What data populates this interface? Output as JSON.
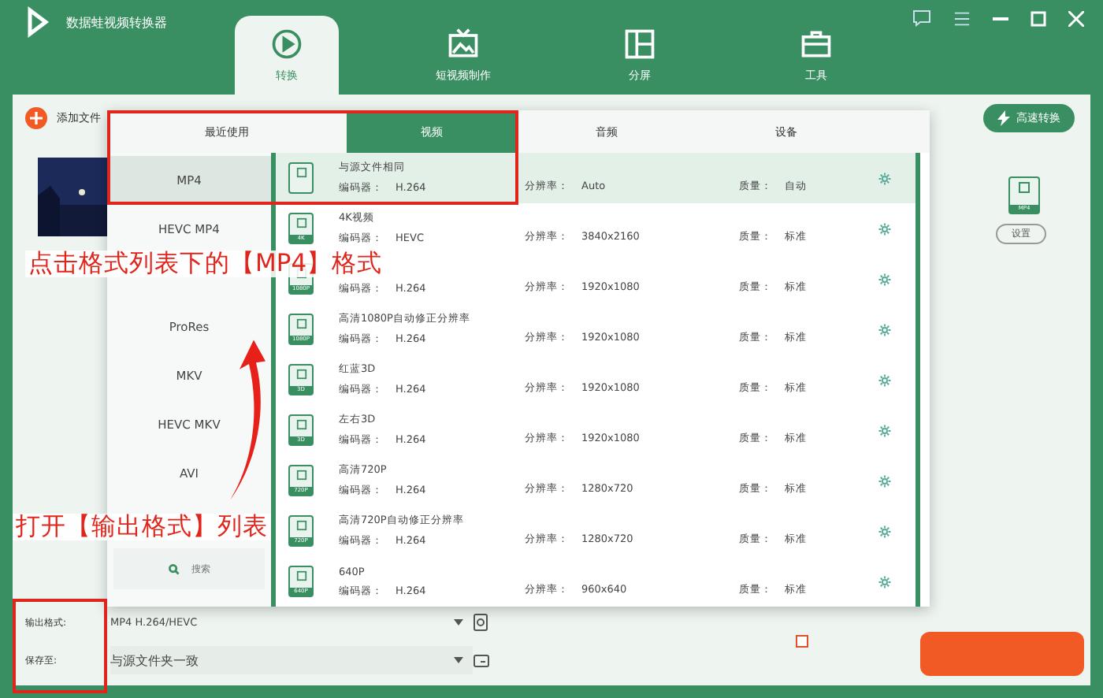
{
  "app": {
    "title": "数据蛙视频转换器"
  },
  "nav_tabs": [
    {
      "label": "转换",
      "kind": "convert",
      "selected": true
    },
    {
      "label": "短视频制作",
      "kind": "tv",
      "selected": false
    },
    {
      "label": "分屏",
      "kind": "split",
      "selected": false
    },
    {
      "label": "工具",
      "kind": "toolbox",
      "selected": false
    }
  ],
  "toolbar": {
    "add_file": "添加文件",
    "fast_convert": "高速转换"
  },
  "format_popup": {
    "tabs": [
      {
        "label": "最近使用",
        "selected": false
      },
      {
        "label": "视频",
        "selected": true
      },
      {
        "label": "音频",
        "selected": false
      },
      {
        "label": "设备",
        "selected": false
      }
    ],
    "formats": [
      {
        "label": "MP4",
        "selected": true
      },
      {
        "label": "HEVC MP4",
        "selected": false
      },
      {
        "label": "ProRes",
        "selected": false
      },
      {
        "label": "MKV",
        "selected": false
      },
      {
        "label": "HEVC MKV",
        "selected": false
      },
      {
        "label": "AVI",
        "selected": false
      }
    ],
    "search": "搜索",
    "presets": [
      {
        "title": "与源文件相同",
        "encoder_label": "编码器：",
        "encoder": "H.264",
        "resolution_label": "分辨率：",
        "resolution": "Auto",
        "quality_label": "质量：",
        "quality": "自动",
        "selected": true
      },
      {
        "title": "4K视频",
        "badge": "4K",
        "encoder_label": "编码器：",
        "encoder": "HEVC",
        "resolution_label": "分辨率：",
        "resolution": "3840x2160",
        "quality_label": "质量：",
        "quality": "标准",
        "selected": false
      },
      {
        "badge": "1080P",
        "encoder_label": "编码器：",
        "encoder": "H.264",
        "resolution_label": "分辨率：",
        "resolution": "1920x1080",
        "quality_label": "质量：",
        "quality": "标准",
        "selected": false
      },
      {
        "title": "高清1080P自动修正分辨率",
        "badge": "1080P",
        "encoder_label": "编码器：",
        "encoder": "H.264",
        "resolution_label": "分辨率：",
        "resolution": "1920x1080",
        "quality_label": "质量：",
        "quality": "标准",
        "selected": false
      },
      {
        "title": "红蓝3D",
        "badge": "3D",
        "encoder_label": "编码器：",
        "encoder": "H.264",
        "resolution_label": "分辨率：",
        "resolution": "1920x1080",
        "quality_label": "质量：",
        "quality": "标准",
        "selected": false
      },
      {
        "title": "左右3D",
        "badge": "3D",
        "encoder_label": "编码器：",
        "encoder": "H.264",
        "resolution_label": "分辨率：",
        "resolution": "1920x1080",
        "quality_label": "质量：",
        "quality": "标准",
        "selected": false
      },
      {
        "title": "高清720P",
        "badge": "720P",
        "encoder_label": "编码器：",
        "encoder": "H.264",
        "resolution_label": "分辨率：",
        "resolution": "1280x720",
        "quality_label": "质量：",
        "quality": "标准",
        "selected": false
      },
      {
        "title": "高清720P自动修正分辨率",
        "badge": "720P",
        "encoder_label": "编码器：",
        "encoder": "H.264",
        "resolution_label": "分辨率：",
        "resolution": "1280x720",
        "quality_label": "质量：",
        "quality": "标准",
        "selected": false
      },
      {
        "title": "640P",
        "badge": "640P",
        "encoder_label": "编码器：",
        "encoder": "H.264",
        "resolution_label": "分辨率：",
        "resolution": "960x640",
        "quality_label": "质量：",
        "quality": "标准",
        "selected": false
      }
    ]
  },
  "output": {
    "format_badge": "MP4",
    "settings": "设置"
  },
  "merge_checkbox": {
    "checked": false
  },
  "bottom": {
    "format_label": "输出格式:",
    "format_value": "MP4 H.264/HEVC",
    "save_label": "保存至:",
    "save_value": "与源文件夹一致"
  },
  "annotations": [
    {
      "text": "点击格式列表下的【MP4】格式"
    },
    {
      "text": "打开【输出格式】列表"
    }
  ]
}
